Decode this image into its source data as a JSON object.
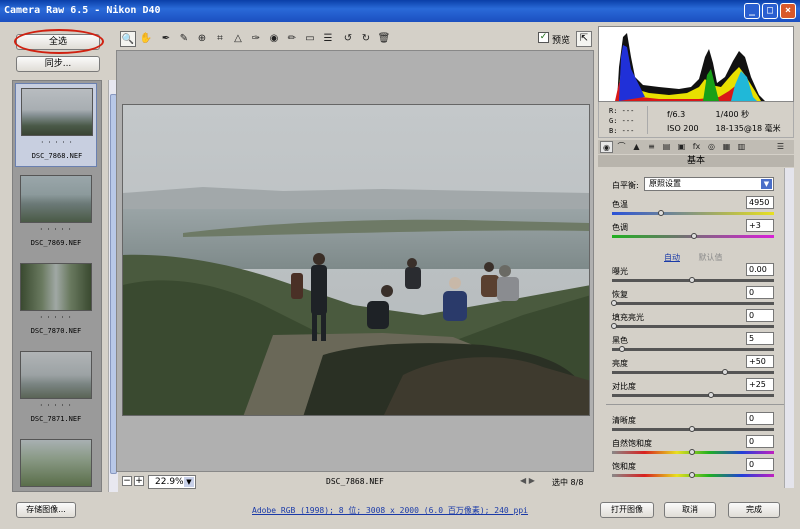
{
  "window": {
    "title": "Camera Raw 6.5 -  Nikon D40",
    "min": "_",
    "max": "□",
    "close": "×"
  },
  "left": {
    "select_all": "全选",
    "sync": "同步...",
    "films": [
      {
        "stars": "· · · · ·",
        "name": "DSC_7868.NEF"
      },
      {
        "stars": "· · · · ·",
        "name": "DSC_7869.NEF"
      },
      {
        "stars": "· · · · ·",
        "name": "DSC_7870.NEF"
      },
      {
        "stars": "· · · · ·",
        "name": "DSC_7871.NEF"
      }
    ]
  },
  "toolbar": {
    "tools": [
      "zoom-icon",
      "hand-icon",
      "eyedropper-icon",
      "color-sampler-icon",
      "target-adjust-icon",
      "crop-icon",
      "straighten-icon",
      "spot-removal-icon",
      "red-eye-icon",
      "adjustment-brush-icon",
      "graduated-filter-icon",
      "preferences-icon",
      "rotate-left-icon",
      "rotate-right-icon",
      "trash-icon"
    ],
    "preview_checked": true,
    "preview_label": "预览"
  },
  "preview": {
    "zoom_minus": "−",
    "zoom_plus": "+",
    "zoom": "22.9%",
    "file": "DSC_7868.NEF",
    "nav_arrows": "◀ ▶",
    "selected": "选中 8/8"
  },
  "info": {
    "r": "R:  ---",
    "g": "G:  ---",
    "b": "B:  ---",
    "aperture": "f/6.3",
    "shutter": "1/400 秒",
    "iso": "ISO 200",
    "lens": "18-135@18 毫米"
  },
  "panel": {
    "title": "基本",
    "wb_label": "白平衡:",
    "wb_value": "原照设置",
    "temp_label": "色温",
    "temp_value": "4950",
    "tint_label": "色调",
    "tint_value": "+3",
    "auto": "自动",
    "default": "默认值",
    "exposure_label": "曝光",
    "exposure_value": "0.00",
    "recovery_label": "恢复",
    "recovery_value": "0",
    "fill_label": "填充亮光",
    "fill_value": "0",
    "blacks_label": "黑色",
    "blacks_value": "5",
    "brightness_label": "亮度",
    "brightness_value": "+50",
    "contrast_label": "对比度",
    "contrast_value": "+25",
    "clarity_label": "清晰度",
    "clarity_value": "0",
    "vibrance_label": "自然饱和度",
    "vibrance_value": "0",
    "saturation_label": "饱和度",
    "saturation_value": "0",
    "slider_levels": {
      "temp": 0.3,
      "tint": 0.51,
      "exposure": 0.5,
      "recovery": 0.0,
      "fill": 0.0,
      "blacks": 0.05,
      "brightness": 0.71,
      "contrast": 0.62,
      "clarity": 0.5,
      "vibrance": 0.5,
      "saturation": 0.5
    }
  },
  "bottom": {
    "save": "存储图像...",
    "meta": "Adobe RGB (1998); 8 位; 3008 x 2000 (6.0 百万像素); 240 ppi",
    "open": "打开图像",
    "cancel": "取消",
    "done": "完成"
  },
  "colors": {
    "title_bar": "#1b4fc0",
    "highlight_ring": "#d02010",
    "link": "#1a3aa8"
  }
}
